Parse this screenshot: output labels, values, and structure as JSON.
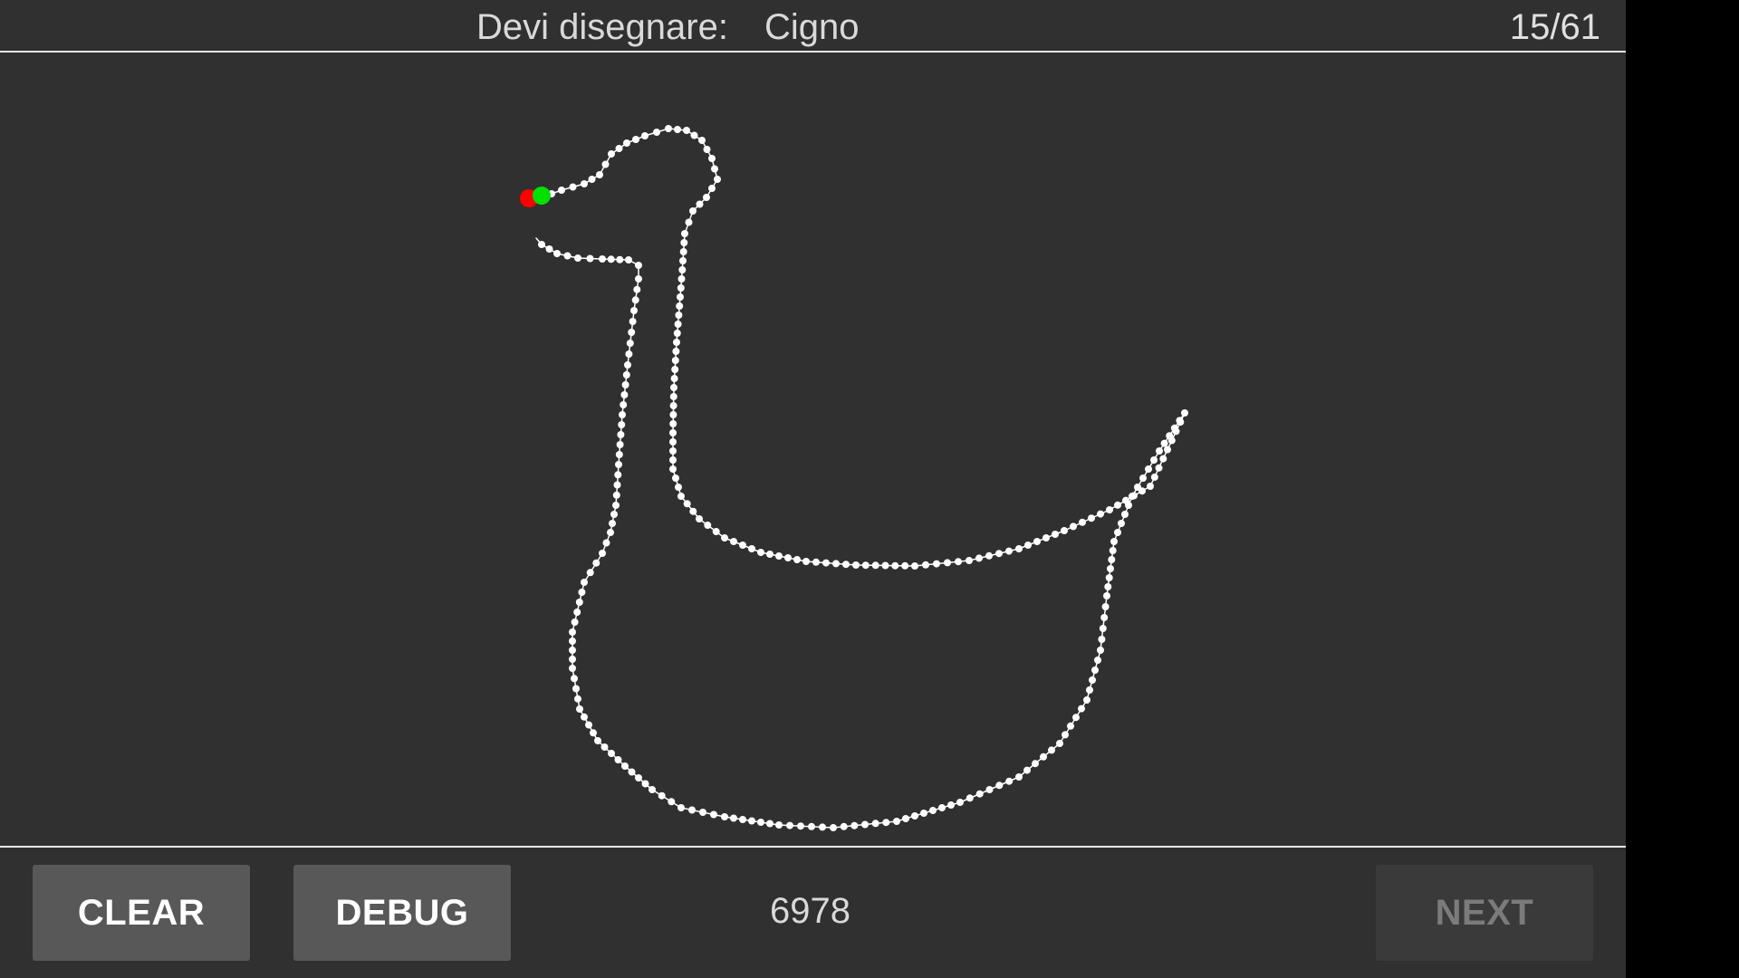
{
  "header": {
    "prompt_label": "Devi disegnare:",
    "prompt_word": "Cigno",
    "counter": "15/61"
  },
  "footer": {
    "clear_label": "CLEAR",
    "debug_label": "DEBUG",
    "score": "6978",
    "next_label": "NEXT"
  },
  "colors": {
    "background": "#303030",
    "stroke": "#ffffff",
    "start_marker": "#ff0000",
    "end_marker": "#00e000"
  }
}
